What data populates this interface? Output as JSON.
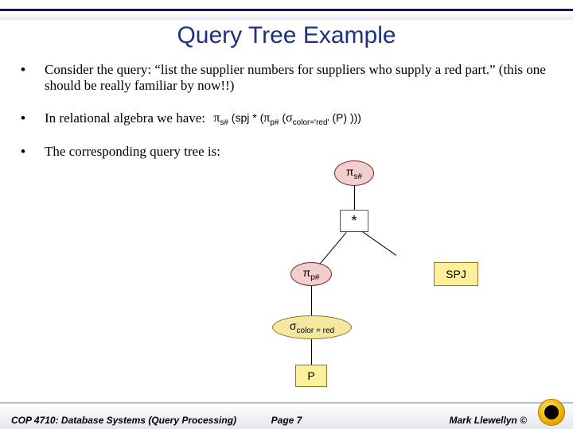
{
  "title": "Query Tree Example",
  "bullets": [
    "Consider the query: “list the supplier numbers for suppliers who supply a red part.”  (this one should be really familiar by now!!)",
    "In relational algebra we have:",
    "The corresponding query tree is:"
  ],
  "ra_formula": {
    "pi1": "π",
    "pi1_sub": "s#",
    "open1": "(",
    "spj": "spj",
    "join": " * ",
    "open2": "(",
    "pi2": "π",
    "pi2_sub": "p#",
    "open3": "(",
    "sigma": "σ",
    "sigma_sub": "color='red'",
    "open4": "(",
    "P": "P",
    "close4": ")",
    "close3": ")",
    "close2": ")",
    "close1": ")"
  },
  "tree": {
    "n_pi_s": {
      "op": "π",
      "sub": "s#"
    },
    "n_star": "*",
    "n_pi_p": {
      "op": "π",
      "sub": "p#"
    },
    "n_spj": "SPJ",
    "n_sigma": {
      "op": "σ",
      "sub": "color = red"
    },
    "n_P": "P"
  },
  "footer": {
    "left": "COP 4710: Database Systems (Query Processing)",
    "center": "Page 7",
    "right": "Mark Llewellyn ©"
  }
}
